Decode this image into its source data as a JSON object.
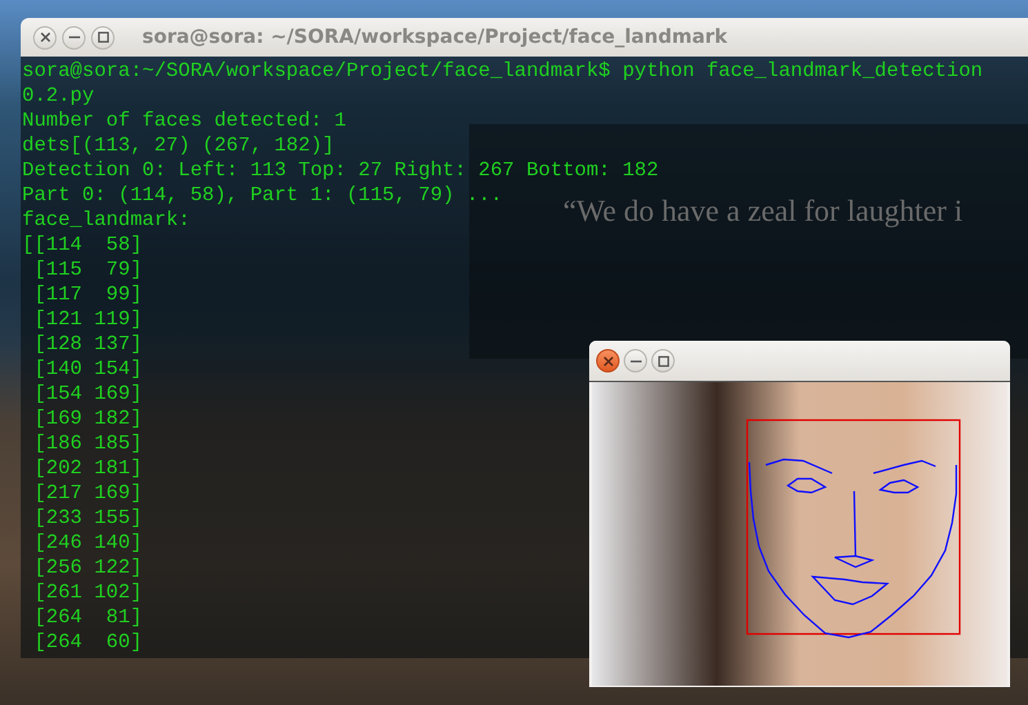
{
  "desktop_quote": "“We do have a zeal for laughter i",
  "terminal": {
    "title": "sora@sora: ~/SORA/workspace/Project/face_landmark",
    "lines": [
      "sora@sora:~/SORA/workspace/Project/face_landmark$ python face_landmark_detection",
      "0.2.py",
      "Number of faces detected: 1",
      "dets[(113, 27) (267, 182)]",
      "Detection 0: Left: 113 Top: 27 Right: 267 Bottom: 182",
      "Part 0: (114, 58), Part 1: (115, 79) ...",
      "face_landmark:",
      "[[114  58]",
      " [115  79]",
      " [117  99]",
      " [121 119]",
      " [128 137]",
      " [140 154]",
      " [154 169]",
      " [169 182]",
      " [186 185]",
      " [202 181]",
      " [217 169]",
      " [233 155]",
      " [246 140]",
      " [256 122]",
      " [261 102]",
      " [264  81]",
      " [264  60]"
    ]
  }
}
